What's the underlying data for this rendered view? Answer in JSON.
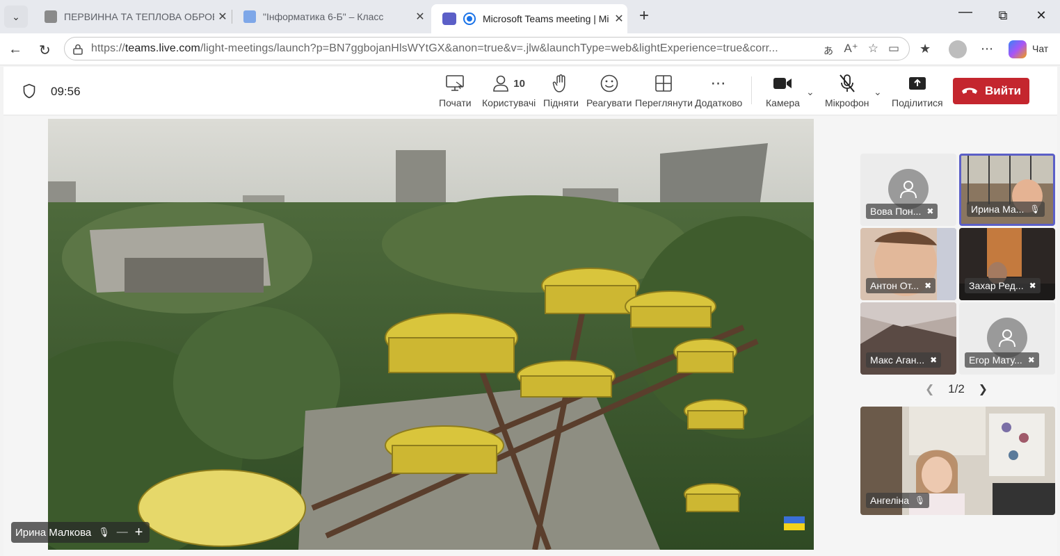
{
  "browser": {
    "tabs": [
      {
        "title": "ПЕРВИННА ТА ТЕПЛОВА ОБРОБКА",
        "active": false
      },
      {
        "title": "\"Інформатика 6-Б\" – Класс",
        "active": false
      },
      {
        "title": "Microsoft Teams meeting | Mi",
        "active": true
      }
    ],
    "url_prefix": "https://",
    "url_host": "teams.live.com",
    "url_rest": "/light-meetings/launch?p=BN7ggbojanHlsWYtGX&anon=true&v=.jlw&launchType=web&lightExperience=true&corr...",
    "copilot_label": "Чат"
  },
  "meeting": {
    "timer": "09:56",
    "toolbar": {
      "start_label": "Почати",
      "people_count": "10",
      "people_label": "Користувачі",
      "raise_label": "Підняти",
      "react_label": "Реагувати",
      "view_label": "Переглянути",
      "more_label": "Додатково",
      "camera_label": "Камера",
      "mic_label": "Мікрофон",
      "share_label": "Поділитися",
      "leave_label": "Вийти"
    },
    "presenter_name": "Ирина Малкова",
    "participants": [
      {
        "name": "Вова Пон...",
        "type": "avatar"
      },
      {
        "name": "Ирина Ма...",
        "type": "video"
      },
      {
        "name": "Антон От...",
        "type": "video"
      },
      {
        "name": "Захар Ред...",
        "type": "video"
      },
      {
        "name": "Макс Аган...",
        "type": "video"
      },
      {
        "name": "Егор Мату...",
        "type": "avatar"
      }
    ],
    "pager": "1/2",
    "self_view_name": "Ангеліна"
  },
  "colors": {
    "leave": "#c4262e",
    "teams_accent": "#5b5fc7"
  }
}
